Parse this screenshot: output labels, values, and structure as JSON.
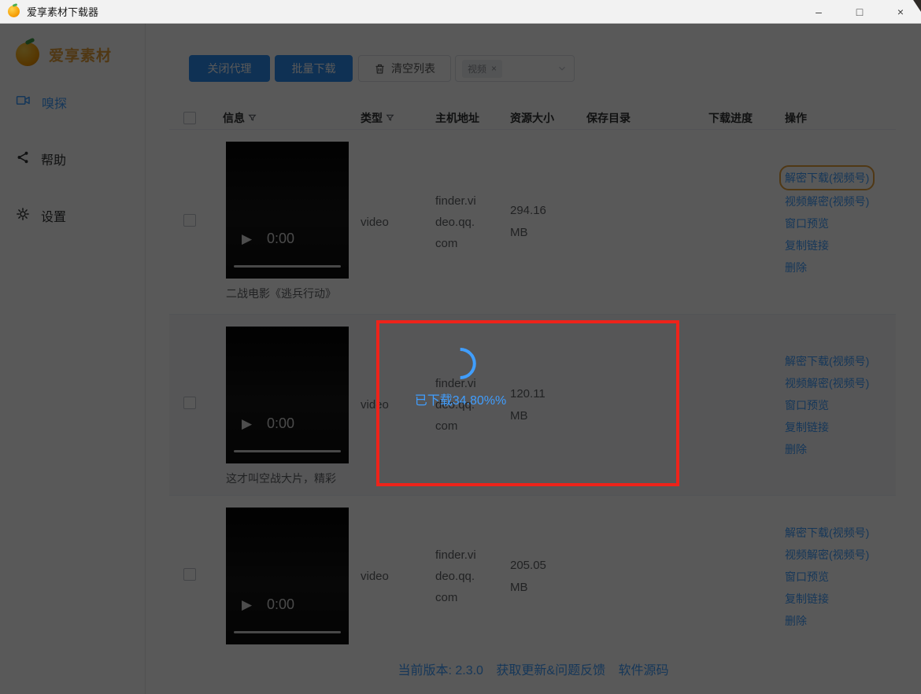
{
  "window": {
    "title": "爱享素材下载器",
    "controls": {
      "minimize": "–",
      "maximize": "□",
      "close": "×"
    }
  },
  "sidebar": {
    "logo_text": "爱享素材",
    "items": [
      {
        "label": "嗅探",
        "icon": "video-camera-icon",
        "active": true
      },
      {
        "label": "帮助",
        "icon": "share-icon",
        "active": false
      },
      {
        "label": "设置",
        "icon": "gear-icon",
        "active": false
      }
    ]
  },
  "toolbar": {
    "close_proxy_label": "关闭代理",
    "batch_download_label": "批量下载",
    "clear_list_label": "清空列表",
    "filter_tag": "视频",
    "tag_close": "×"
  },
  "table": {
    "headers": [
      "信息",
      "类型",
      "主机地址",
      "资源大小",
      "保存目录",
      "下载进度",
      "操作"
    ]
  },
  "rows": [
    {
      "title": "二战电影《逃兵行动》",
      "type": "video",
      "host": "finder.video.qq.com",
      "size": "294.16 MB",
      "duration": "0:00",
      "save_dir": "",
      "progress": ""
    },
    {
      "title": "这才叫空战大片，精彩",
      "type": "video",
      "host": "finder.video.qq.com",
      "size": "120.11 MB",
      "duration": "0:00",
      "save_dir": "",
      "progress": ""
    },
    {
      "title": "",
      "type": "video",
      "host": "finder.video.qq.com",
      "size": "205.05 MB",
      "duration": "0:00",
      "save_dir": "",
      "progress": ""
    }
  ],
  "actions": [
    "解密下载(视频号)",
    "视频解密(视频号)",
    "窗口预览",
    "复制链接",
    "删除"
  ],
  "player": {
    "play_glyph": "▶"
  },
  "loading": {
    "text": "已下载34.80%%"
  },
  "footer": {
    "version": "当前版本: 2.3.0",
    "update_link": "获取更新&问题反馈",
    "source_link": "软件源码"
  },
  "colors": {
    "accent_blue": "#409eff",
    "button_blue": "#2d8cf0",
    "logo_orange": "#e6a23c",
    "annotation_red": "#ee231a",
    "mask": "rgba(0,0,0,0.65)"
  }
}
